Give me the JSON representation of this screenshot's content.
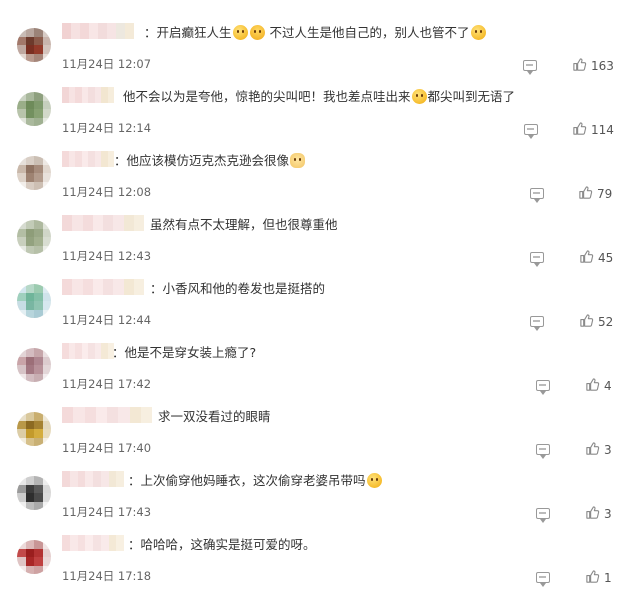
{
  "comments": [
    {
      "avatar": [
        "#c8bcb6",
        "#b8a69e",
        "#9b8378",
        "#d8ccc6",
        "#a2786a",
        "#6d3a2c",
        "#8a5a4a",
        "#c9b5ad",
        "#bfa8a0",
        "#7a2f22",
        "#933a2a",
        "#d4c4bd",
        "#e2d6d0",
        "#b99a8e",
        "#a5867a",
        "#e8ded9"
      ],
      "name_colors": [
        "#f1d2d2",
        "#f6e1e1",
        "#f3d8d8",
        "#f8e6e6",
        "#f2dcdc",
        "#f6e4e4",
        "#ede8df",
        "#f4ead8"
      ],
      "segments": [
        {
          "type": "text",
          "value": "：开启癫狂人生"
        },
        {
          "type": "emoji",
          "name": "laugh-cry-emoji"
        },
        {
          "type": "emoji",
          "name": "laugh-emoji"
        },
        {
          "type": "text",
          "value": " 不过人生是他自己的，别人也管不了"
        },
        {
          "type": "emoji",
          "name": "shy-emoji"
        }
      ],
      "time": "11月24日 12:07",
      "likes": "163"
    },
    {
      "avatar": [
        "#c9d2c1",
        "#a9b89c",
        "#8ea07e",
        "#d7dccf",
        "#9aae89",
        "#6e8b5a",
        "#7f9a6c",
        "#c6cfbd",
        "#b8c4ab",
        "#73905f",
        "#87a172",
        "#d2d8c9",
        "#e0e4da",
        "#aab99d",
        "#9fb091",
        "#e6eae1"
      ],
      "name_colors": [
        "#f2d6d6",
        "#f7e3e3",
        "#f4dada",
        "#f9e8e8",
        "#f3dede",
        "#f7e6e6",
        "#f2e6d0",
        "#f6eddc"
      ],
      "segments": [
        {
          "type": "text",
          "value": "他不会以为是夸他，惊艳的尖叫吧！我也差点哇出来"
        },
        {
          "type": "emoji",
          "name": "laugh-cry-emoji"
        },
        {
          "type": "text",
          "value": "都尖叫到无语了"
        }
      ],
      "time": "11月24日 12:14",
      "likes": "114"
    },
    {
      "avatar": [
        "#e6e0da",
        "#d9cfc6",
        "#cbbfb4",
        "#eee9e4",
        "#c9b8aa",
        "#8f7362",
        "#a68c7c",
        "#e1d7ce",
        "#ddd2c8",
        "#9e8372",
        "#b39c8d",
        "#e8e1db",
        "#f2eeea",
        "#d8ccc2",
        "#cdbfb3",
        "#f5f1ee"
      ],
      "name_colors": [
        "#f4dada",
        "#f8e6e6",
        "#f5dede",
        "#faeaea",
        "#f4e0e0",
        "#f8e8e8",
        "#f3e7d2",
        "#f7eede"
      ],
      "segments": [
        {
          "type": "text",
          "value": "：他应该模仿迈克杰克逊会很像"
        },
        {
          "type": "emoji",
          "name": "cat-emoji"
        }
      ],
      "time": "11月24日 12:08",
      "likes": "79"
    },
    {
      "avatar": [
        "#d6dbd0",
        "#c2cbb7",
        "#aeb99f",
        "#e0e4da",
        "#b3bea4",
        "#8e9d79",
        "#9aa887",
        "#d0d6c8",
        "#c8cfbd",
        "#93a27f",
        "#a3b08f",
        "#d8ddd1",
        "#e6e9e2",
        "#bfc8b3",
        "#b6c0a8",
        "#eceee8"
      ],
      "name_colors": [
        "#f3d9d9",
        "#f7e5e5",
        "#f4dcdc",
        "#f9e9e9",
        "#f3dfdf",
        "#f7e7e7",
        "#f2e8d6",
        "#f6eedf"
      ],
      "segments": [
        {
          "type": "text",
          "value": "虽然有点不太理解，但也很尊重他"
        }
      ],
      "time": "11月24日 12:43",
      "likes": "45"
    },
    {
      "avatar": [
        "#d2e6ee",
        "#b6d8c8",
        "#9ccbb0",
        "#dcebf1",
        "#9fd0be",
        "#6fb59a",
        "#84c0a8",
        "#cfe3ea",
        "#c7dde4",
        "#79b6a2",
        "#8fc4b1",
        "#d6e8ee",
        "#e3eff3",
        "#b7d5dc",
        "#a9cbd4",
        "#e9f2f5"
      ],
      "name_colors": [
        "#f4dada",
        "#f8e6e6",
        "#f5dede",
        "#faeaea",
        "#f4e0e0",
        "#f8e8e8",
        "#f3e8d4",
        "#f7efe0"
      ],
      "segments": [
        {
          "type": "text",
          "value": "：小香风和他的卷发也是挺搭的"
        }
      ],
      "time": "11月24日 12:44",
      "likes": "52"
    },
    {
      "avatar": [
        "#e2d4d6",
        "#d4bcc0",
        "#c6a6aa",
        "#ebe0e2",
        "#c9a4a8",
        "#9c6f78",
        "#ae8690",
        "#dccbce",
        "#d6c3c6",
        "#a37882",
        "#b8929a",
        "#e3d6d8",
        "#efe6e7",
        "#d2bcc0",
        "#c8aeb2",
        "#f3ecee"
      ],
      "name_colors": [
        "#f5dcdc",
        "#f9e8e8",
        "#f6e0e0",
        "#fbecec",
        "#f5e2e2",
        "#f9eaea",
        "#f4e9d6",
        "#f8f0e2"
      ],
      "segments": [
        {
          "type": "text",
          "value": "：他是不是穿女装上瘾了?"
        }
      ],
      "time": "11月24日 17:42",
      "likes": "4"
    },
    {
      "avatar": [
        "#e8dfc8",
        "#d9c89c",
        "#c9ae6e",
        "#efe8d6",
        "#b99848",
        "#8c6a22",
        "#a58232",
        "#e3d8bc",
        "#dccda6",
        "#c39a2c",
        "#d4ad3e",
        "#e8dcbc",
        "#f2ecdc",
        "#d6c08a",
        "#c9b074",
        "#f6f1e6"
      ],
      "name_colors": [
        "#f4dada",
        "#f8e6e6",
        "#f5dede",
        "#faeaea",
        "#f4e0e0",
        "#f8e8e8",
        "#f3e8d4",
        "#f7efe0"
      ],
      "segments": [
        {
          "type": "text",
          "value": "求一双没看过的眼睛"
        }
      ],
      "time": "11月24日 17:40",
      "likes": "3"
    },
    {
      "avatar": [
        "#e8e8e8",
        "#cfcfcf",
        "#b4b4b4",
        "#eeeeee",
        "#9a9a9a",
        "#3c3c3c",
        "#5a5a5a",
        "#d8d8d8",
        "#cccccc",
        "#2e2e2e",
        "#4a4a4a",
        "#dcdcdc",
        "#efefef",
        "#bdbdbd",
        "#aaaaaa",
        "#f3f3f3"
      ],
      "name_colors": [
        "#f3d9d9",
        "#f7e5e5",
        "#f4dcdc",
        "#f9e9e9",
        "#f3dfdf",
        "#f7e7e7",
        "#f2e8d6",
        "#f6eedf"
      ],
      "segments": [
        {
          "type": "text",
          "value": "：上次偷穿他妈睡衣，这次偷穿老婆吊带吗"
        },
        {
          "type": "emoji",
          "name": "laugh-cry-emoji"
        }
      ],
      "time": "11月24日 17:43",
      "likes": "3"
    },
    {
      "avatar": [
        "#ecdada",
        "#dcb8b8",
        "#c99696",
        "#f2e6e6",
        "#c24a4a",
        "#9a1e1e",
        "#b23232",
        "#e6cfcf",
        "#dfc4c4",
        "#a82626",
        "#bf4040",
        "#ead8d8",
        "#f4eaea",
        "#d6b0b0",
        "#cea2a2",
        "#f7f0f0"
      ],
      "name_colors": [
        "#f5dcdc",
        "#f9e8e8",
        "#f6e0e0",
        "#fbecec",
        "#f5e2e2",
        "#f9eaea",
        "#f4e9d6",
        "#f8f0e2"
      ],
      "segments": [
        {
          "type": "text",
          "value": "：哈哈哈，这确实是挺可爱的呀。"
        }
      ],
      "time": "11月24日 17:18",
      "likes": "1"
    }
  ]
}
